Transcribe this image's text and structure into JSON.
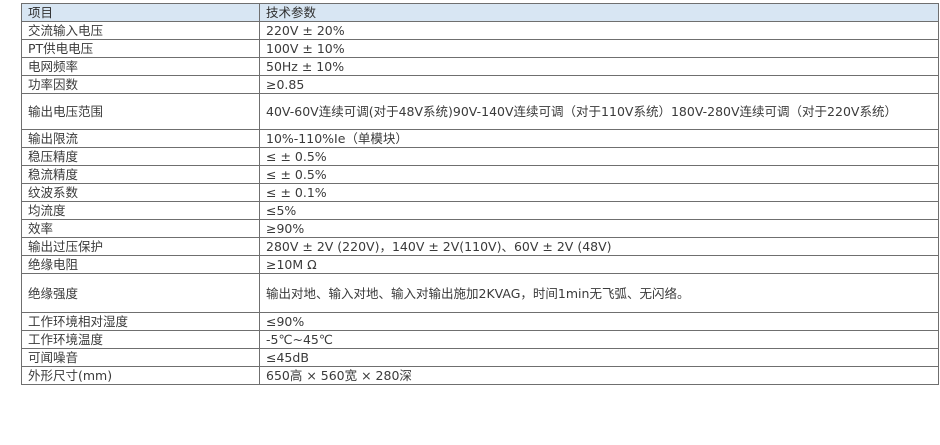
{
  "table": {
    "headers": [
      "项目",
      "技术参数"
    ],
    "rows": [
      {
        "item": "交流输入电压",
        "value": "220V ± 20%"
      },
      {
        "item": "PT供电电压",
        "value": "100V ± 10%"
      },
      {
        "item": "电网频率",
        "value": "50Hz ± 10%"
      },
      {
        "item": "功率因数",
        "value": "≥0.85"
      },
      {
        "item": "输出电压范围",
        "value": "40V-60V连续可调(对于48V系统)90V-140V连续可调（对于110V系统）180V-280V连续可调（对于220V系统）"
      },
      {
        "item": "输出限流",
        "value": "10%-110%Ie（单模块）"
      },
      {
        "item": "稳压精度",
        "value": "≤ ± 0.5%"
      },
      {
        "item": "稳流精度",
        "value": "≤ ± 0.5%"
      },
      {
        "item": "纹波系数",
        "value": "≤ ± 0.1%"
      },
      {
        "item": "均流度",
        "value": "≤5%"
      },
      {
        "item": "效率",
        "value": "≥90%"
      },
      {
        "item": "输出过压保护",
        "value": "280V ± 2V (220V)，140V ± 2V(110V)、60V ± 2V (48V)"
      },
      {
        "item": "绝缘电阻",
        "value": "≥10M Ω"
      },
      {
        "item": "绝缘强度",
        "value": "输出对地、输入对地、输入对输出施加2KVAG，时间1min无飞弧、无闪络。"
      },
      {
        "item": "工作环境相对湿度",
        "value": "≤90%"
      },
      {
        "item": "工作环境温度",
        "value": "-5℃~45℃"
      },
      {
        "item": "可闻噪音",
        "value": "≤45dB"
      },
      {
        "item": "外形尺寸(mm)",
        "value": "650高 × 560宽 × 280深"
      }
    ]
  },
  "colors": {
    "header_bg": "#d8e6f3",
    "border": "#6f6f6f",
    "text": "#3a3a3a"
  }
}
